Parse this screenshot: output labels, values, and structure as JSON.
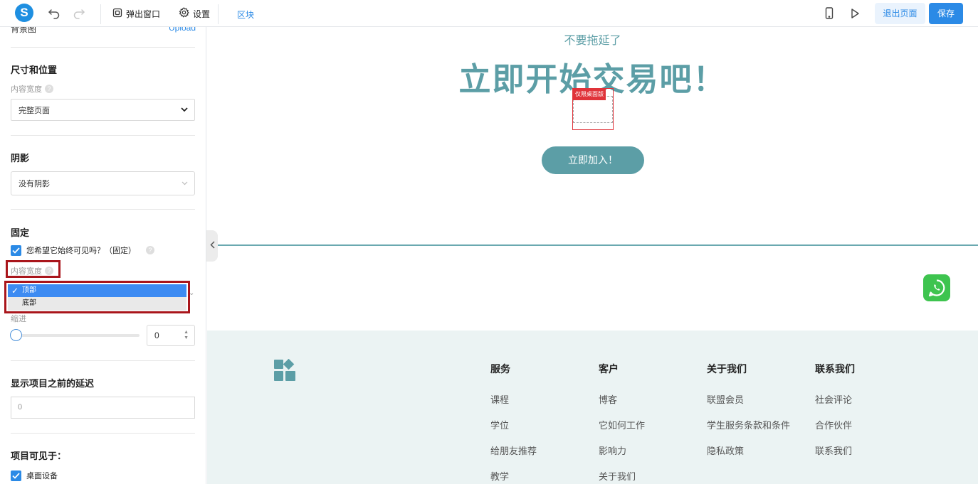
{
  "toolbar": {
    "logo": "S",
    "popup_label": "弹出窗口",
    "settings_label": "设置",
    "block_label": "区块",
    "exit_label": "退出页面",
    "save_label": "保存"
  },
  "panel": {
    "bg_image_label": "背景图",
    "upload_label": "Upload",
    "size_section": {
      "title": "尺寸和位置",
      "content_width_label": "内容宽度",
      "content_width_value": "完整页面"
    },
    "shadow_section": {
      "title": "阴影",
      "value": "没有阴影"
    },
    "fixed_section": {
      "title": "固定",
      "always_visible_label": "您希望它始终可见吗？（固定）",
      "always_visible_checked": true,
      "content_width_label": "内容宽度",
      "position_options": [
        "顶部",
        "底部"
      ],
      "position_selected": "顶部",
      "indent_label": "缩进",
      "indent_value": "0"
    },
    "delay_section": {
      "title": "显示项目之前的延迟",
      "value": "0"
    },
    "visibility_section": {
      "title": "项目可见于：",
      "desktop_label": "桌面设备",
      "desktop_checked": true
    }
  },
  "canvas": {
    "subheading": "不要拖延了",
    "headline": "立即开始交易吧！",
    "desktop_only_tag": "仅限桌面版",
    "cta_label": "立即加入！",
    "footer": {
      "columns": [
        {
          "title": "服务",
          "items": [
            "课程",
            "学位",
            "给朋友推荐",
            "教学"
          ]
        },
        {
          "title": "客户",
          "items": [
            "博客",
            "它如何工作",
            "影响力",
            "关于我们"
          ]
        },
        {
          "title": "关于我们",
          "items": [
            "联盟会员",
            "学生服务条款和条件",
            "隐私政策"
          ]
        },
        {
          "title": "联系我们",
          "items": [
            "社会评论",
            "合作伙伴",
            "联系我们"
          ]
        }
      ]
    }
  },
  "colors": {
    "accent": "#2b8ae6",
    "brand_teal": "#5c9ea6",
    "highlight_red": "#a9151b",
    "whatsapp_green": "#3ec44f"
  }
}
